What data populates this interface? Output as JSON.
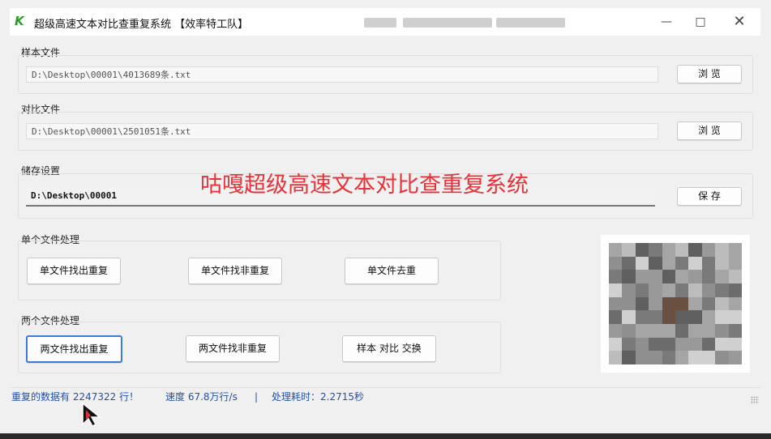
{
  "titlebar": {
    "title": "超级高速文本对比查重复系统 【效率特工队】",
    "logo": "K",
    "minimize_icon": "minimize-icon",
    "maximize_icon": "maximize-icon",
    "close_icon": "close-icon"
  },
  "sample": {
    "label": "样本文件",
    "path": "D:\\Desktop\\00001\\4013689条.txt",
    "browse": "浏 览"
  },
  "compare": {
    "label": "对比文件",
    "path": "D:\\Desktop\\00001\\2501051条.txt",
    "browse": "浏 览"
  },
  "storage": {
    "label": "储存设置",
    "path": "D:\\Desktop\\00001",
    "save": "保 存"
  },
  "overlay_title": "咕嘎超级高速文本对比查重复系统",
  "single": {
    "label": "单个文件处理",
    "find_dup": "单文件找出重复",
    "find_nondup": "单文件找非重复",
    "dedupe": "单文件去重"
  },
  "double": {
    "label": "两个文件处理",
    "find_dup": "两文件找出重复",
    "find_nondup": "两文件找非重复",
    "swap": "样本 对比 交换"
  },
  "status": {
    "dup_rows": "重复的数据有 2247322 行！",
    "speed": "速度 67.8万行/s",
    "sep": "|",
    "elapsed": "处理耗时：2.2715秒"
  },
  "colors": {
    "overlay_red": "#e8323a",
    "status_blue": "#2450a8",
    "focus_blue": "#3b7cd6"
  }
}
